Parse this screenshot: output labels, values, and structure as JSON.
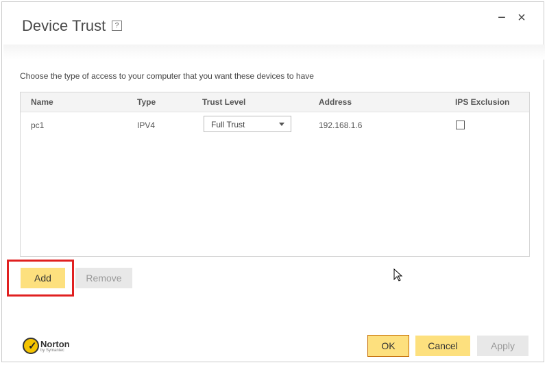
{
  "window": {
    "title": "Device Trust",
    "help_glyph": "?",
    "minimize_glyph": "−",
    "close_glyph": "×"
  },
  "instruction": "Choose the type of access to your computer that you want these devices to have",
  "table": {
    "columns": [
      "Name",
      "Type",
      "Trust Level",
      "Address",
      "IPS Exclusion"
    ],
    "rows": [
      {
        "name": "pc1",
        "type": "IPV4",
        "trust_level": "Full Trust",
        "address": "192.168.1.6",
        "ips_exclusion": false
      }
    ]
  },
  "buttons": {
    "add": "Add",
    "remove": "Remove",
    "ok": "OK",
    "cancel": "Cancel",
    "apply": "Apply"
  },
  "brand": {
    "name": "Norton",
    "sub": "by Symantec",
    "check_glyph": "✓"
  },
  "colors": {
    "primary_button": "#fde07e",
    "disabled_button": "#e8e8e8",
    "highlight": "#e02020"
  }
}
